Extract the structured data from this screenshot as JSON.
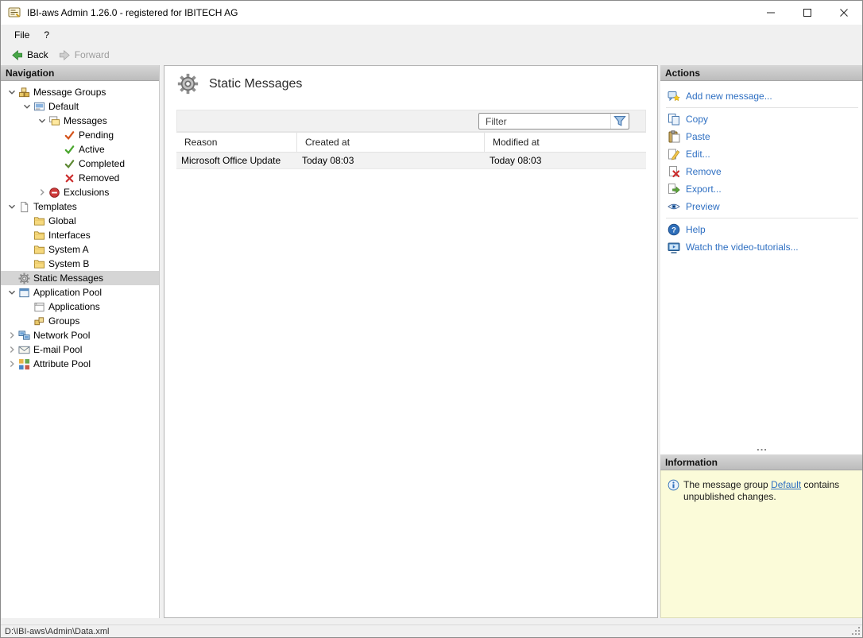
{
  "window": {
    "title": "IBI-aws Admin 1.26.0 - registered for IBITECH AG",
    "menu": [
      "File",
      "?"
    ],
    "toolbar": {
      "back": "Back",
      "forward": "Forward"
    },
    "controls": {
      "minimize": "minimize",
      "maximize": "maximize",
      "close": "close"
    }
  },
  "navigation": {
    "header": "Navigation",
    "tree": [
      {
        "label": "Message Groups",
        "level": 0,
        "chevron": "down",
        "icon": "message-groups",
        "selected": false
      },
      {
        "label": "Default",
        "level": 1,
        "chevron": "down",
        "icon": "default-group",
        "selected": false
      },
      {
        "label": "Messages",
        "level": 2,
        "chevron": "down",
        "icon": "messages",
        "selected": false
      },
      {
        "label": "Pending",
        "level": 3,
        "chevron": "none",
        "icon": "pending",
        "selected": false
      },
      {
        "label": "Active",
        "level": 3,
        "chevron": "none",
        "icon": "active",
        "selected": false
      },
      {
        "label": "Completed",
        "level": 3,
        "chevron": "none",
        "icon": "completed",
        "selected": false
      },
      {
        "label": "Removed",
        "level": 3,
        "chevron": "none",
        "icon": "removed",
        "selected": false
      },
      {
        "label": "Exclusions",
        "level": 2,
        "chevron": "right",
        "icon": "exclusions",
        "selected": false
      },
      {
        "label": "Templates",
        "level": 0,
        "chevron": "down",
        "icon": "templates",
        "selected": false
      },
      {
        "label": "Global",
        "level": 1,
        "chevron": "none",
        "icon": "folder",
        "selected": false
      },
      {
        "label": "Interfaces",
        "level": 1,
        "chevron": "none",
        "icon": "folder",
        "selected": false
      },
      {
        "label": "System A",
        "level": 1,
        "chevron": "none",
        "icon": "folder",
        "selected": false
      },
      {
        "label": "System B",
        "level": 1,
        "chevron": "none",
        "icon": "folder",
        "selected": false
      },
      {
        "label": "Static Messages",
        "level": 0,
        "chevron": "none",
        "icon": "static-messages",
        "selected": true
      },
      {
        "label": "Application Pool",
        "level": 0,
        "chevron": "down",
        "icon": "application-pool",
        "selected": false
      },
      {
        "label": "Applications",
        "level": 1,
        "chevron": "none",
        "icon": "applications",
        "selected": false
      },
      {
        "label": "Groups",
        "level": 1,
        "chevron": "none",
        "icon": "groups",
        "selected": false
      },
      {
        "label": "Network Pool",
        "level": 0,
        "chevron": "right",
        "icon": "network-pool",
        "selected": false
      },
      {
        "label": "E-mail Pool",
        "level": 0,
        "chevron": "right",
        "icon": "email-pool",
        "selected": false
      },
      {
        "label": "Attribute Pool",
        "level": 0,
        "chevron": "right",
        "icon": "attribute-pool",
        "selected": false
      }
    ]
  },
  "main": {
    "title": "Static Messages",
    "title_icon": "static-messages",
    "filter_placeholder": "Filter",
    "table": {
      "columns": [
        "Reason",
        "Created at",
        "Modified at"
      ],
      "rows": [
        [
          "Microsoft Office Update",
          "Today 08:03",
          "Today 08:03"
        ]
      ]
    }
  },
  "actions": {
    "header": "Actions",
    "items": [
      {
        "label": "Add new message...",
        "icon": "add-message",
        "divider_after": true
      },
      {
        "label": "Copy",
        "icon": "copy",
        "divider_after": false
      },
      {
        "label": "Paste",
        "icon": "paste",
        "divider_after": false
      },
      {
        "label": "Edit...",
        "icon": "edit",
        "divider_after": false
      },
      {
        "label": "Remove",
        "icon": "remove",
        "divider_after": false
      },
      {
        "label": "Export...",
        "icon": "export",
        "divider_after": false
      },
      {
        "label": "Preview",
        "icon": "preview",
        "divider_after": true
      },
      {
        "label": "Help",
        "icon": "help",
        "divider_after": false
      },
      {
        "label": "Watch the video-tutorials...",
        "icon": "video",
        "divider_after": false
      }
    ]
  },
  "information": {
    "header": "Information",
    "text_before": "The message group ",
    "link": "Default",
    "text_after": " contains unpublished changes."
  },
  "statusbar": {
    "path": "D:\\IBI-aws\\Admin\\Data.xml"
  },
  "colors": {
    "link": "#2e6fc2",
    "selection": "#d5d5d5",
    "info_background": "#fbfbd9",
    "panel_header": "#bcbcbc"
  }
}
